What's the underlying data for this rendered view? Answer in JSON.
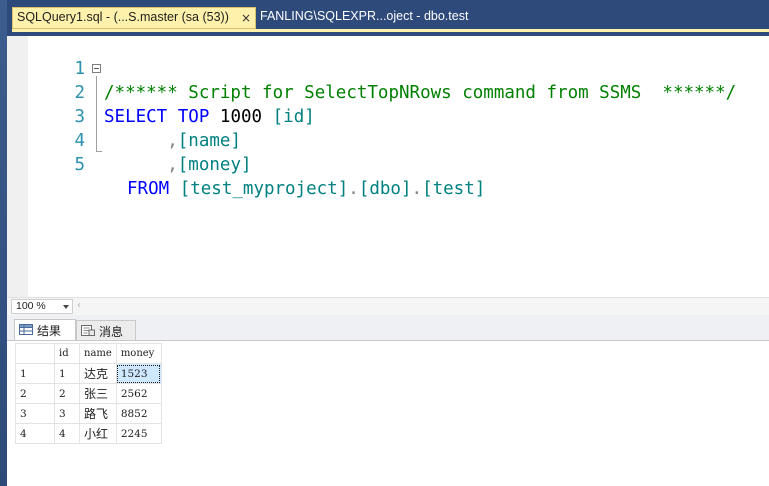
{
  "tabs": [
    {
      "label": "SQLQuery1.sql - (...S.master (sa (53))",
      "active": true,
      "close_glyph": "×"
    },
    {
      "label": "FANLING\\SQLEXPR...oject - dbo.test",
      "active": false
    }
  ],
  "editor": {
    "lines": [
      {
        "num": "1",
        "comment": "/****** Script for SelectTopNRows command from SSMS  ******/"
      },
      {
        "num": "2",
        "kw1": "SELECT",
        "kw2": "TOP",
        "number": "1000",
        "ident": "[id]"
      },
      {
        "num": "3",
        "prefix": "      ,",
        "ident": "[name]"
      },
      {
        "num": "4",
        "prefix": "      ,",
        "ident": "[money]"
      },
      {
        "num": "5",
        "kw": "FROM",
        "ident1": "[test_myproject]",
        "dot1": ".",
        "ident2": "[dbo]",
        "dot2": ".",
        "ident3": "[test]"
      }
    ]
  },
  "zoom": {
    "value": "100 %"
  },
  "results_tabs": [
    {
      "label": "结果",
      "icon": "grid-icon"
    },
    {
      "label": "消息",
      "icon": "messages-icon"
    }
  ],
  "grid": {
    "columns": [
      "id",
      "name",
      "money"
    ],
    "rows": [
      {
        "rn": "1",
        "id": "1",
        "name": "达克",
        "money": "1523"
      },
      {
        "rn": "2",
        "id": "2",
        "name": "张三",
        "money": "2562"
      },
      {
        "rn": "3",
        "id": "3",
        "name": "路飞",
        "money": "8852"
      },
      {
        "rn": "4",
        "id": "4",
        "name": "小红",
        "money": "2245"
      }
    ],
    "selected": {
      "row": 0,
      "column": "money"
    }
  },
  "colors": {
    "keyword": "#0000ff",
    "comment": "#008000",
    "identifier": "#008080",
    "line_number": "#2b91af",
    "active_tab": "#fdf1ac",
    "tabbar": "#2e4a7b"
  }
}
